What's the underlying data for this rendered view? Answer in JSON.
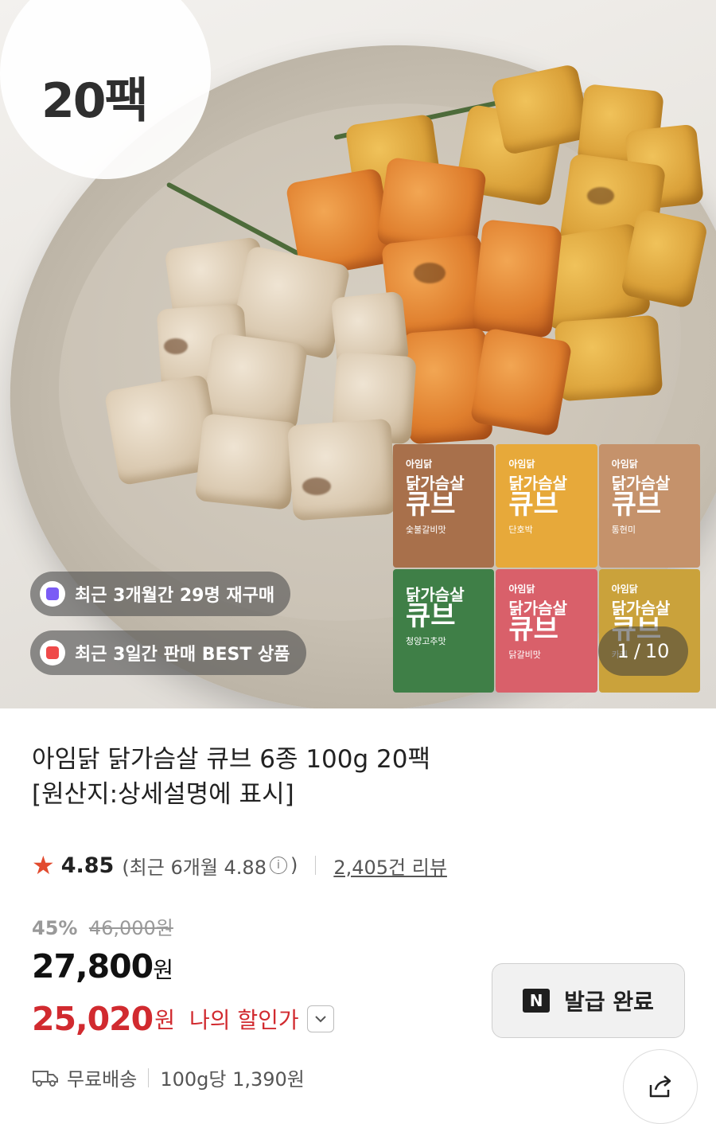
{
  "hero": {
    "pack_badge": "20팩",
    "pills": [
      {
        "text": "최근 3개월간 29명 재구매",
        "icon": "repurchase-bag-icon",
        "color": "#7b5cf5"
      },
      {
        "text": "최근 3일간 판매 BEST 상품",
        "icon": "gift-box-icon",
        "color": "#ef4a4a"
      }
    ],
    "packs": [
      {
        "brand": "아임닭",
        "name": "닭가슴살",
        "cube": "큐브",
        "flavor": "숯불갈비맛",
        "color": "#a8704b"
      },
      {
        "brand": "아임닭",
        "name": "닭가슴살",
        "cube": "큐브",
        "flavor": "단호박",
        "color": "#e7a93a"
      },
      {
        "brand": "아임닭",
        "name": "닭가슴살",
        "cube": "큐브",
        "flavor": "통현미",
        "color": "#c5926b"
      },
      {
        "brand": "",
        "name": "닭가슴살",
        "cube": "큐브",
        "flavor": "청양고추맛",
        "color": "#3f7f47"
      },
      {
        "brand": "아임닭",
        "name": "닭가슴살",
        "cube": "큐브",
        "flavor": "닭갈비맛",
        "color": "#d9606a"
      },
      {
        "brand": "아임닭",
        "name": "닭가슴살",
        "cube": "큐브",
        "flavor": "카레",
        "color": "#caa23b"
      }
    ],
    "counter": {
      "current": "1",
      "separator": "/",
      "total": "10"
    }
  },
  "product": {
    "title_line1": "아임닭 닭가슴살 큐브 6종 100g 20팩",
    "title_line2": "[원산지:상세설명에 표시]"
  },
  "rating": {
    "score": "4.85",
    "recent_open": "(최근 6개월 4.88",
    "info_glyph": "i",
    "recent_close": ")",
    "reviews": "2,405건 리뷰"
  },
  "pricing": {
    "discount": "45%",
    "original": "46,000원",
    "price_value": "27,800",
    "price_unit": "원",
    "my_price_value": "25,020",
    "my_price_unit": "원",
    "my_price_label": "나의 할인가"
  },
  "coupon": {
    "logo": "N",
    "label": "발급 완료"
  },
  "shipping": {
    "free": "무료배송",
    "unit_price": "100g당 1,390원"
  }
}
